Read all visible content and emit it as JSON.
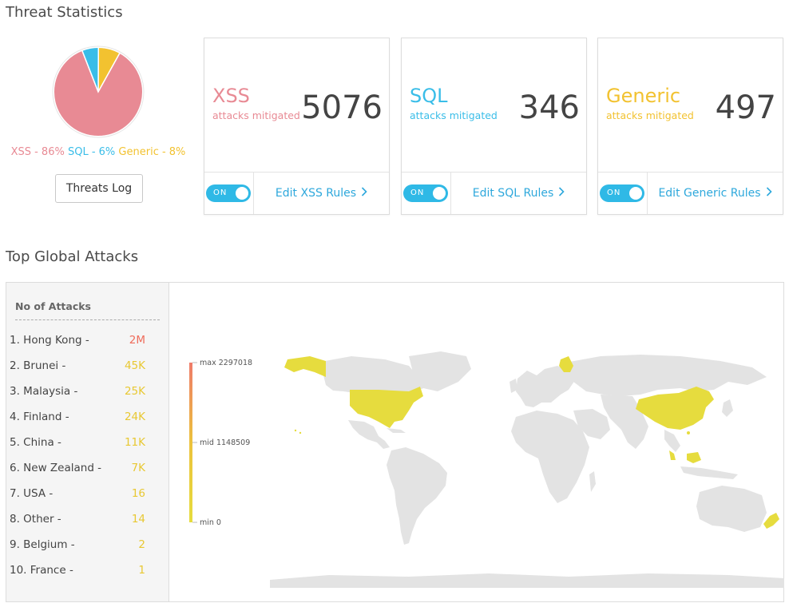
{
  "threat_statistics": {
    "title": "Threat Statistics",
    "pie": {
      "slices": [
        {
          "name": "XSS",
          "percent": 86,
          "color": "#e88a94"
        },
        {
          "name": "SQL",
          "percent": 6,
          "color": "#39bde8"
        },
        {
          "name": "Generic",
          "percent": 8,
          "color": "#f2c230"
        }
      ],
      "legend": {
        "xss": "XSS - 86%",
        "sql": "SQL - 6%",
        "generic": "Generic - 8%"
      }
    },
    "threats_log_button": "Threats Log"
  },
  "cards": [
    {
      "name": "XSS",
      "sub": "attacks mitigated",
      "count": "5076",
      "toggle": "ON",
      "edit": "Edit XSS Rules",
      "color": "#e88a94"
    },
    {
      "name": "SQL",
      "sub": "attacks mitigated",
      "count": "346",
      "toggle": "ON",
      "edit": "Edit SQL Rules",
      "color": "#39bde8"
    },
    {
      "name": "Generic",
      "sub": "attacks mitigated",
      "count": "497",
      "toggle": "ON",
      "edit": "Edit Generic Rules",
      "color": "#f2c230"
    }
  ],
  "top_global_attacks": {
    "title": "Top Global Attacks",
    "list_title": "No of Attacks",
    "rows": [
      {
        "label": "1. Hong Kong -",
        "value": "2M"
      },
      {
        "label": "2. Brunei -",
        "value": "45K"
      },
      {
        "label": "3. Malaysia -",
        "value": "25K"
      },
      {
        "label": "4. Finland -",
        "value": "24K"
      },
      {
        "label": "5. China -",
        "value": "11K"
      },
      {
        "label": "6. New Zealand -",
        "value": "7K"
      },
      {
        "label": "7. USA -",
        "value": "16"
      },
      {
        "label": "8. Other -",
        "value": "14"
      },
      {
        "label": "9. Belgium -",
        "value": "2"
      },
      {
        "label": "10. France -",
        "value": "1"
      }
    ],
    "scale": {
      "max": "max 2297018",
      "mid": "mid 1148509",
      "min": "min 0",
      "color_max": "#ef7b6a",
      "color_min": "#e6dc3e"
    },
    "map_colors": {
      "land": "#e3e3e3",
      "highlight": "#e6dc3e"
    }
  }
}
